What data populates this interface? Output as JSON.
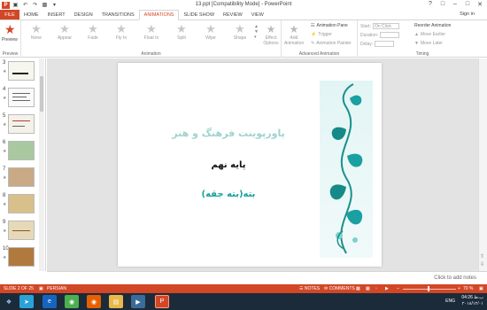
{
  "window": {
    "title": "13.ppt [Compatibility Mode] - PowerPoint",
    "signin": "Sign in",
    "app_logo": "P"
  },
  "tabs": [
    "FILE",
    "HOME",
    "INSERT",
    "DESIGN",
    "TRANSITIONS",
    "ANIMATIONS",
    "SLIDE SHOW",
    "REVIEW",
    "VIEW"
  ],
  "active_tab": "ANIMATIONS",
  "ribbon": {
    "preview": {
      "label": "Preview",
      "group": "Preview"
    },
    "animation_group": "Animation",
    "effects": [
      "None",
      "Appear",
      "Fade",
      "Fly In",
      "Float In",
      "Split",
      "Wipe",
      "Shape"
    ],
    "effect_options": "Effect Options",
    "add_animation": "Add Animation",
    "advanced": {
      "group": "Advanced Animation",
      "animation_pane": "Animation Pane",
      "trigger": "Trigger",
      "animation_painter": "Animation Painter"
    },
    "timing": {
      "group": "Timing",
      "start_label": "Start:",
      "start_value": "On Click",
      "duration_label": "Duration:",
      "delay_label": "Delay:",
      "reorder": "Reorder Animation",
      "move_earlier": "Move Earlier",
      "move_later": "Move Later"
    }
  },
  "thumbnails": [
    {
      "num": "3"
    },
    {
      "num": "4"
    },
    {
      "num": "5"
    },
    {
      "num": "6"
    },
    {
      "num": "7"
    },
    {
      "num": "8"
    },
    {
      "num": "9"
    },
    {
      "num": "10"
    }
  ],
  "slide": {
    "title": "پاورپوینت فرهنگ و هنر",
    "line2": "پایه نهم",
    "line3": "بته(بته جقه)"
  },
  "notes": "Click to add notes",
  "status": {
    "slide": "SLIDE 2 OF 25",
    "language": "PERSIAN",
    "notes": "NOTES",
    "comments": "COMMENTS",
    "zoom": "70 %"
  },
  "taskbar": {
    "lang": "ENG",
    "time": "04:26 ب.ظ",
    "date": "۲۰۱۸/۱۲/۰۱"
  },
  "colors": {
    "accent": "#d24726",
    "taskbar": "#1c2b3a"
  }
}
